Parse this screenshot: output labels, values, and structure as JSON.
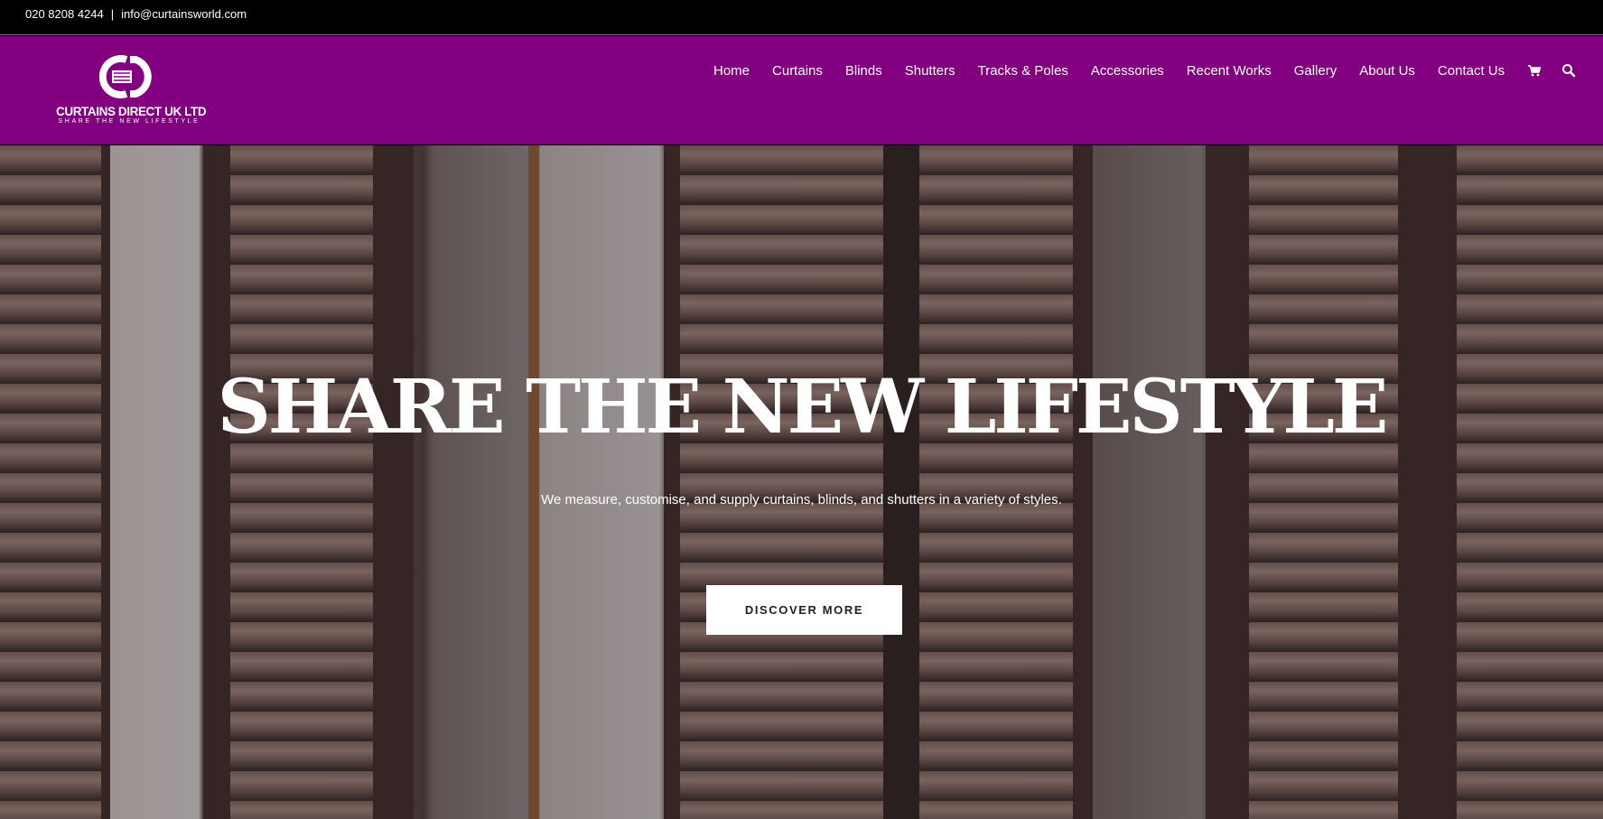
{
  "topbar": {
    "phone": "020 8208 4244",
    "separator": "|",
    "email": "info@curtainsworld.com"
  },
  "logo": {
    "name": "CURTAINS DIRECT UK LTD",
    "tagline": "SHARE THE NEW LIFESTYLE"
  },
  "nav": {
    "items": [
      {
        "label": "Home"
      },
      {
        "label": "Curtains"
      },
      {
        "label": "Blinds"
      },
      {
        "label": "Shutters"
      },
      {
        "label": "Tracks & Poles"
      },
      {
        "label": "Accessories"
      },
      {
        "label": "Recent Works"
      },
      {
        "label": "Gallery"
      },
      {
        "label": "About Us"
      },
      {
        "label": "Contact Us"
      }
    ],
    "icons": [
      "cart-icon",
      "search-icon"
    ]
  },
  "hero": {
    "title": "SHARE THE NEW LIFESTYLE",
    "subtitle": "We measure, customise, and supply curtains, blinds, and shutters in a variety of styles.",
    "cta": "DISCOVER MORE"
  },
  "colors": {
    "header_bg": "#820080",
    "topbar_bg": "#000000",
    "cta_bg": "#ffffff",
    "text": "#ffffff"
  }
}
